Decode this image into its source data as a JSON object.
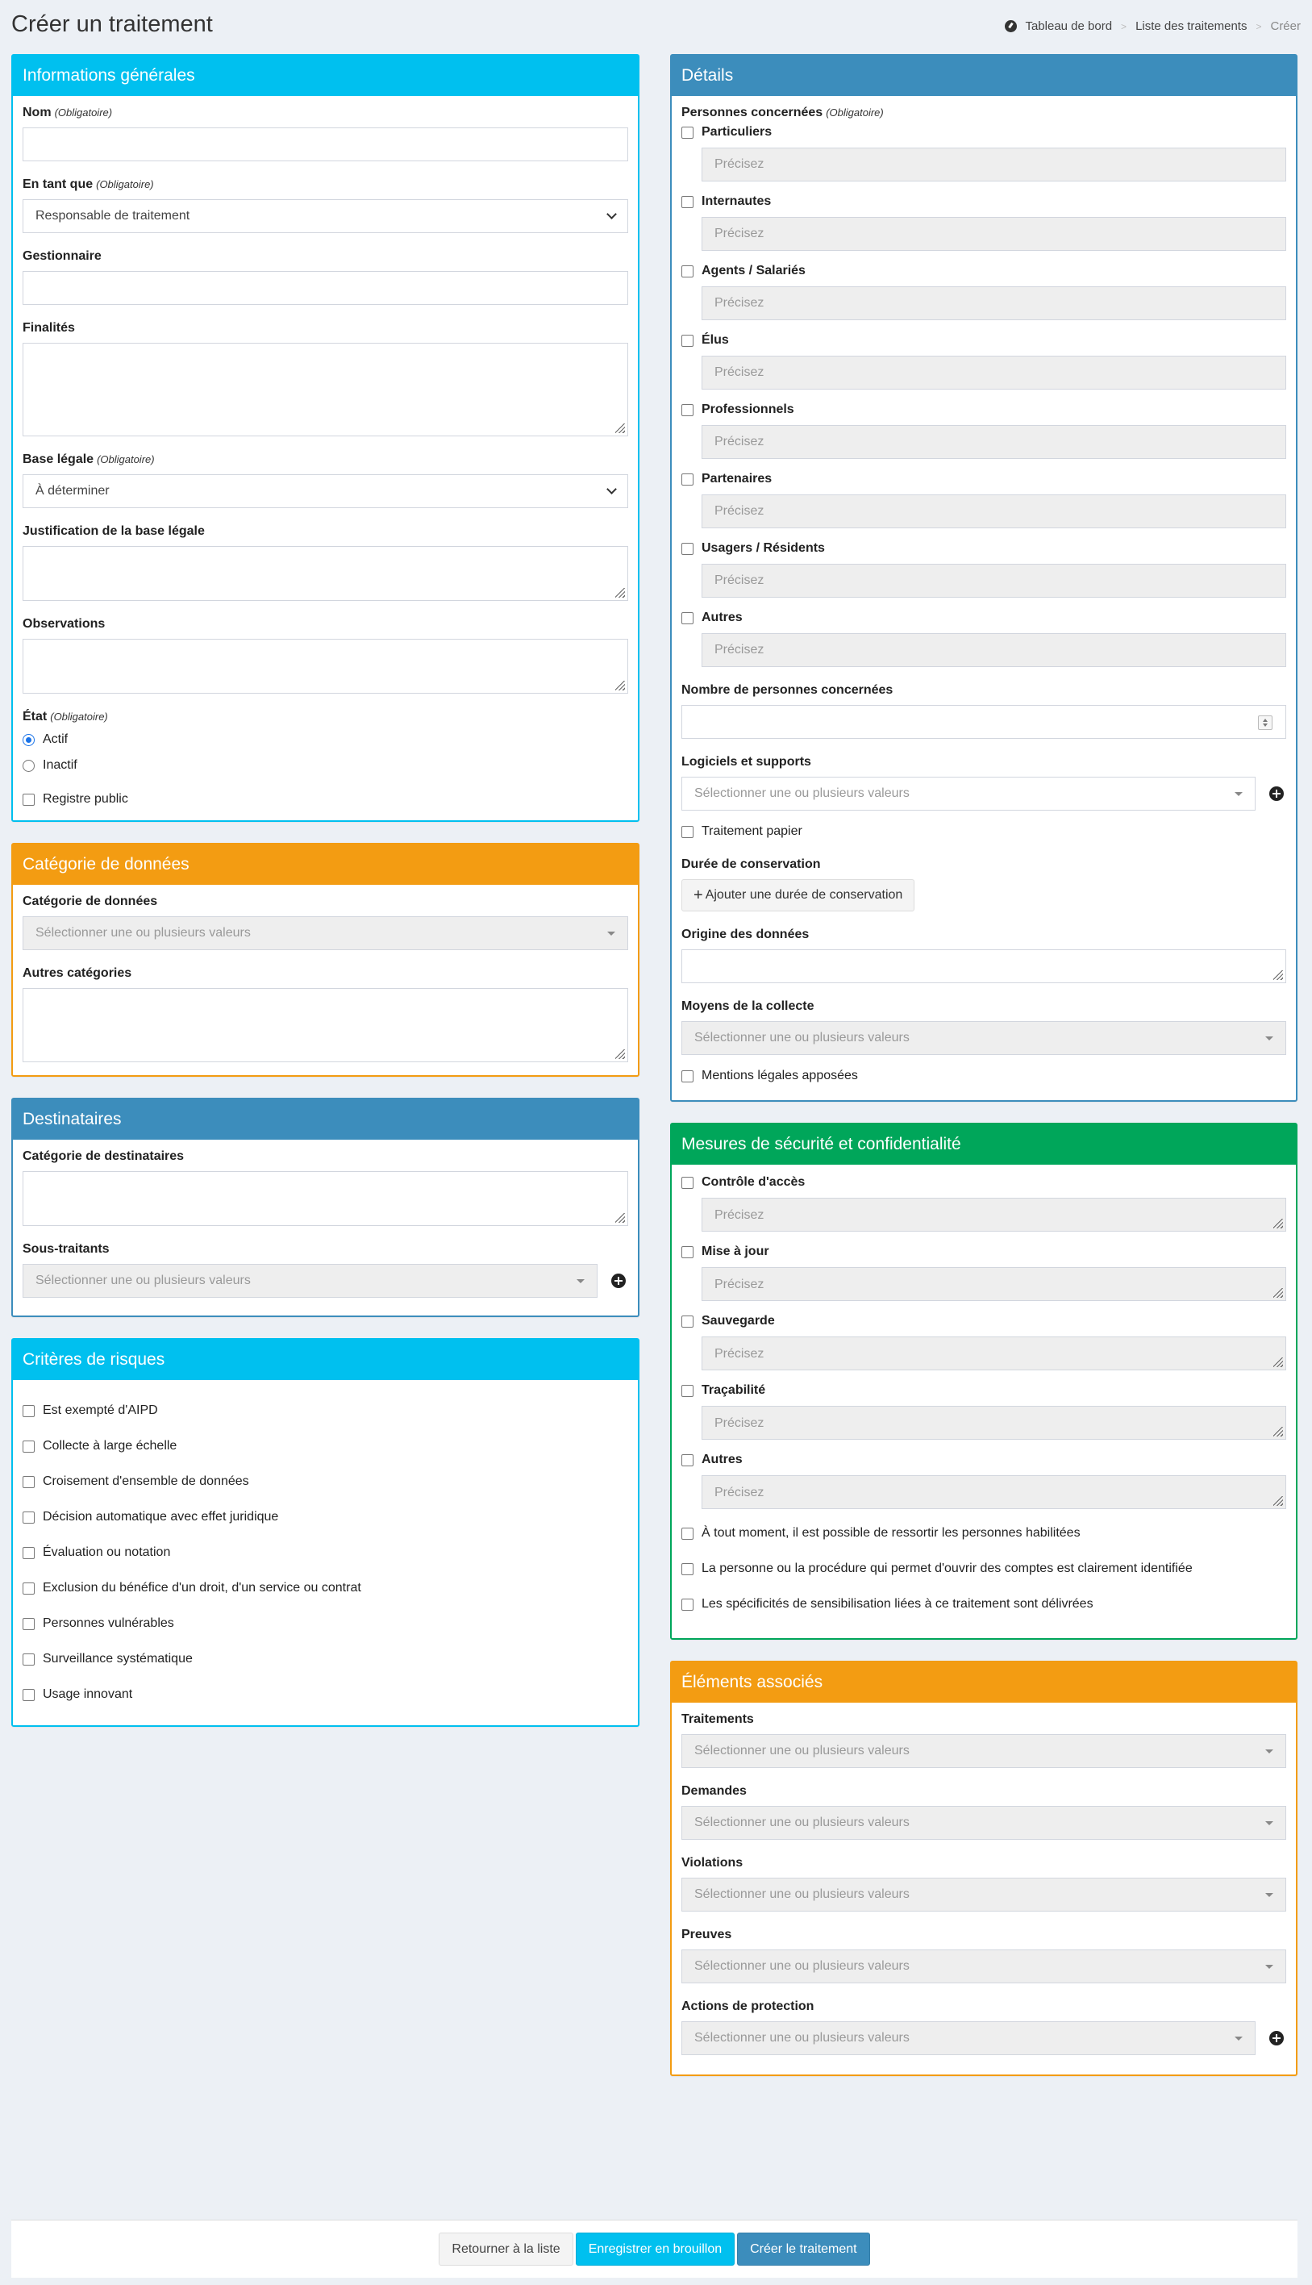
{
  "page": {
    "title": "Créer un traitement",
    "breadcrumb": [
      "Tableau de bord",
      "Liste des traitements",
      "Créer"
    ]
  },
  "required_tag": "(Obligatoire)",
  "general": {
    "header": "Informations générales",
    "nom_label": "Nom",
    "en_tant_que_label": "En tant que",
    "en_tant_que_value": "Responsable de traitement",
    "gestionnaire_label": "Gestionnaire",
    "finalites_label": "Finalités",
    "base_legale_label": "Base légale",
    "base_legale_value": "À déterminer",
    "justification_label": "Justification de la base légale",
    "observations_label": "Observations",
    "etat_label": "État",
    "etat_options": [
      "Actif",
      "Inactif"
    ],
    "etat_selected": "Actif",
    "registre_public": "Registre public"
  },
  "categorie": {
    "header": "Catégorie de données",
    "categorie_label": "Catégorie de données",
    "categorie_placeholder": "Sélectionner une ou plusieurs valeurs",
    "autres_label": "Autres catégories"
  },
  "destinataires": {
    "header": "Destinataires",
    "categorie_label": "Catégorie de destinataires",
    "sous_traitants_label": "Sous-traitants",
    "sous_traitants_placeholder": "Sélectionner une ou plusieurs valeurs"
  },
  "risques": {
    "header": "Critères de risques",
    "items": [
      "Est exempté d'AIPD",
      "Collecte à large échelle",
      "Croisement d'ensemble de données",
      "Décision automatique avec effet juridique",
      "Évaluation ou notation",
      "Exclusion du bénéfice d'un droit, d'un service ou contrat",
      "Personnes vulnérables",
      "Surveillance systématique",
      "Usage innovant"
    ]
  },
  "details": {
    "header": "Détails",
    "personnes_label": "Personnes concernées",
    "precisez": "Précisez",
    "personnes": [
      "Particuliers",
      "Internautes",
      "Agents / Salariés",
      "Élus",
      "Professionnels",
      "Partenaires",
      "Usagers / Résidents",
      "Autres"
    ],
    "nombre_label": "Nombre de personnes concernées",
    "logiciels_label": "Logiciels et supports",
    "logiciels_placeholder": "Sélectionner une ou plusieurs valeurs",
    "traitement_papier": "Traitement papier",
    "duree_label": "Durée de conservation",
    "duree_button": "Ajouter une durée de conservation",
    "origine_label": "Origine des données",
    "moyens_label": "Moyens de la collecte",
    "moyens_placeholder": "Sélectionner une ou plusieurs valeurs",
    "mentions": "Mentions légales apposées"
  },
  "securite": {
    "header": "Mesures de sécurité et confidentialité",
    "precisez": "Précisez",
    "items": [
      "Contrôle d'accès",
      "Mise à jour",
      "Sauvegarde",
      "Traçabilité",
      "Autres"
    ],
    "extra": [
      "À tout moment, il est possible de ressortir les personnes habilitées",
      "La personne ou la procédure qui permet d'ouvrir des comptes est clairement identifiée",
      "Les spécificités de sensibilisation liées à ce traitement sont délivrées"
    ]
  },
  "associes": {
    "header": "Éléments associés",
    "placeholder": "Sélectionner une ou plusieurs valeurs",
    "fields": [
      "Traitements",
      "Demandes",
      "Violations",
      "Preuves",
      "Actions de protection"
    ]
  },
  "footer": {
    "back": "Retourner à la liste",
    "draft": "Enregistrer en brouillon",
    "create": "Créer le traitement"
  }
}
